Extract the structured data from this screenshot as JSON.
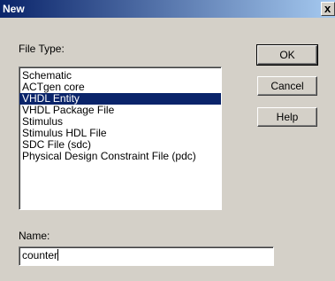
{
  "window": {
    "title": "New",
    "close_glyph": "x"
  },
  "file_type": {
    "label": "File Type:",
    "items": [
      "Schematic",
      "ACTgen core",
      "VHDL Entity",
      "VHDL Package File",
      "Stimulus",
      "Stimulus HDL File",
      "SDC File (sdc)",
      "Physical Design Constraint File (pdc)"
    ],
    "selected": "VHDL Entity"
  },
  "buttons": {
    "ok": "OK",
    "cancel": "Cancel",
    "help": "Help"
  },
  "name": {
    "label": "Name:",
    "value": "counter"
  },
  "colors": {
    "titlebar": "#0a246a",
    "selection": "#0a246a",
    "dialog_bg": "#d4d0c8"
  }
}
